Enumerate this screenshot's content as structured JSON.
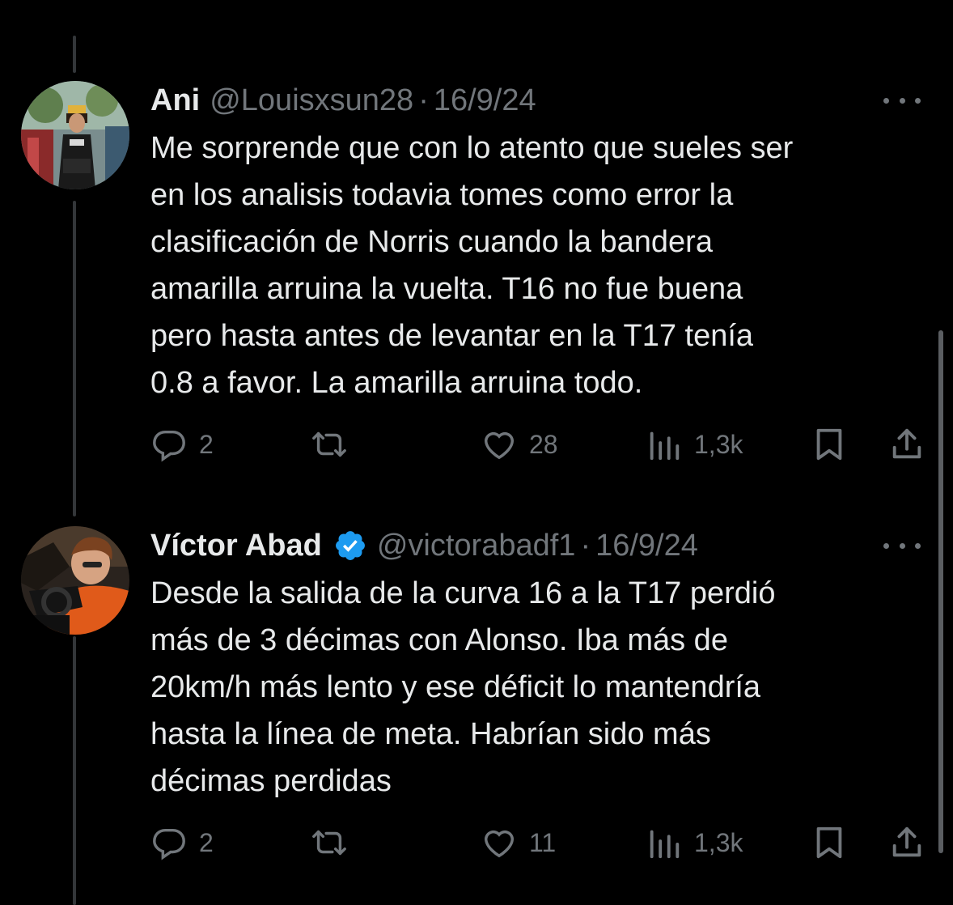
{
  "tweets": [
    {
      "name": "Ani",
      "handle": "@Louisxsun28",
      "separator": "·",
      "date": "16/9/24",
      "verified": false,
      "avatar": "avatar-photo-racing-fan",
      "text": "Me sorprende que con lo atento que sueles ser\nen los analisis todavia tomes como error la\nclasificación de Norris cuando la bandera\namarilla arruina la vuelta. T16 no fue buena\npero hasta antes de levantar en la T17 tenía\n0.8 a favor. La amarilla arruina todo.",
      "replies": "2",
      "retweets": "",
      "likes": "28",
      "views": "1,3k"
    },
    {
      "name": "Víctor Abad",
      "handle": "@victorabadf1",
      "separator": "·",
      "date": "16/9/24",
      "verified": true,
      "avatar": "avatar-photo-simulator",
      "text": "Desde la salida de la curva 16 a la T17 perdió\nmás de 3 décimas con Alonso. Iba más de\n20km/h más lento y ese déficit lo mantendría\nhasta la línea de meta. Habrían sido más\ndécimas perdidas",
      "replies": "2",
      "retweets": "",
      "likes": "11",
      "views": "1,3k"
    }
  ],
  "colors": {
    "background": "#000000",
    "text": "#e7e9ea",
    "muted": "#71767b",
    "verified": "#1d9bf0",
    "thread_line": "#333639"
  }
}
